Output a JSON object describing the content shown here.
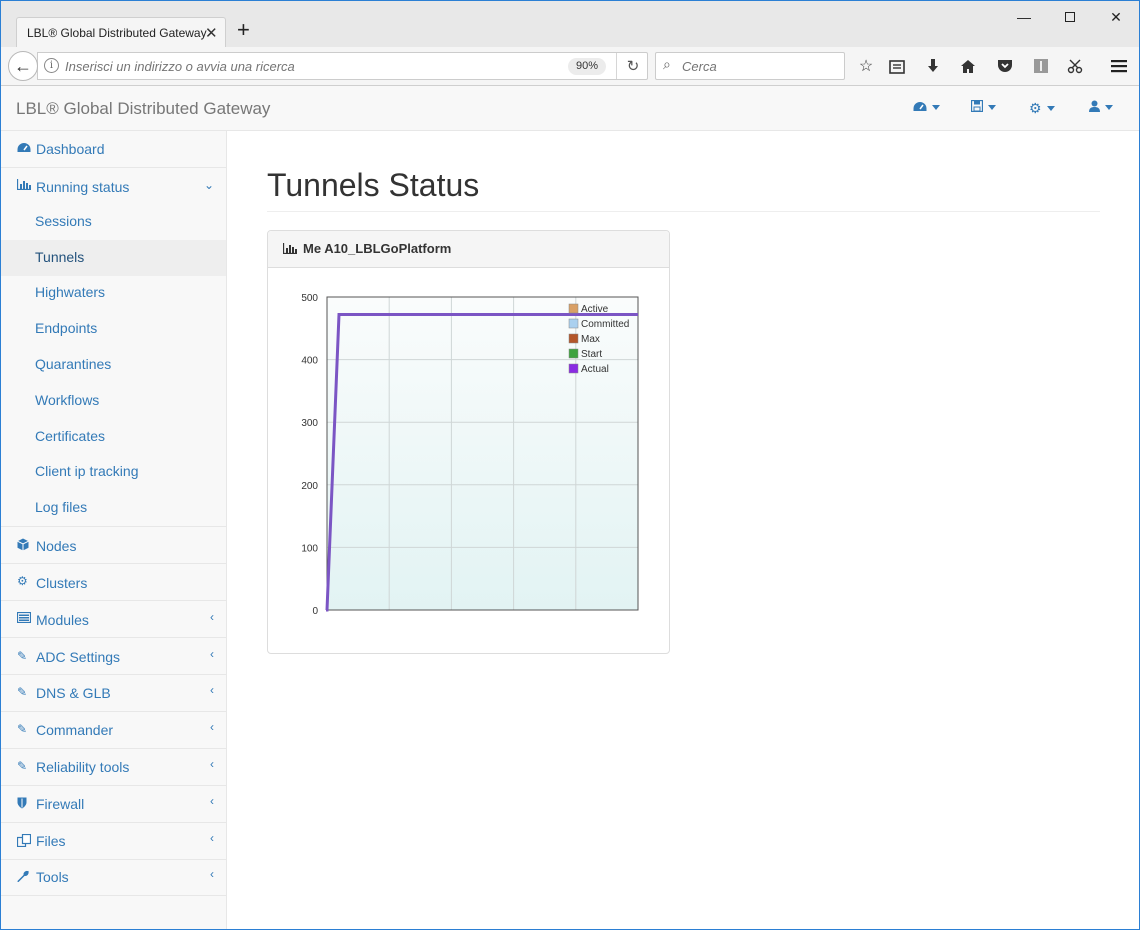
{
  "browser": {
    "tab_title": "LBL® Global Distributed Gateway",
    "url_placeholder": "Inserisci un indirizzo o avvia una ricerca",
    "zoom": "90%",
    "search_placeholder": "Cerca"
  },
  "app": {
    "brand": "LBL® Global Distributed Gateway"
  },
  "sidebar": {
    "dashboard": "Dashboard",
    "running_status": "Running status",
    "sub_items": [
      "Sessions",
      "Tunnels",
      "Highwaters",
      "Endpoints",
      "Quarantines",
      "Workflows",
      "Certificates",
      "Client ip tracking",
      "Log files"
    ],
    "active_sub_item": "Tunnels",
    "nodes": "Nodes",
    "clusters": "Clusters",
    "modules": "Modules",
    "adc_settings": "ADC Settings",
    "dns_glb": "DNS & GLB",
    "commander": "Commander",
    "reliability_tools": "Reliability tools",
    "firewall": "Firewall",
    "files": "Files",
    "tools": "Tools"
  },
  "main": {
    "title": "Tunnels Status",
    "panel_title": "Me A10_LBLGoPlatform"
  },
  "chart_data": {
    "type": "line",
    "title": "",
    "xlabel": "",
    "ylabel": "",
    "ylim": [
      0,
      500
    ],
    "yticks": [
      "0",
      "100",
      "200",
      "300",
      "400",
      "500"
    ],
    "x_grid_divisions": 5,
    "x": [
      0,
      1,
      2,
      3,
      4,
      5,
      6
    ],
    "series": [
      {
        "name": "Active",
        "color": "#d9a066",
        "values": []
      },
      {
        "name": "Committed",
        "color": "#aad0ef",
        "values": []
      },
      {
        "name": "Max",
        "color": "#b3562a",
        "values": []
      },
      {
        "name": "Start",
        "color": "#3fa33f",
        "values": []
      },
      {
        "name": "Actual",
        "color": "#8a2be2",
        "values": [
          0,
          472,
          472,
          472,
          472,
          472,
          472
        ]
      }
    ],
    "legend_position": "top-right",
    "grid": true
  },
  "colors": {
    "link": "#337ab7",
    "plot_line": "#7b55c4"
  }
}
